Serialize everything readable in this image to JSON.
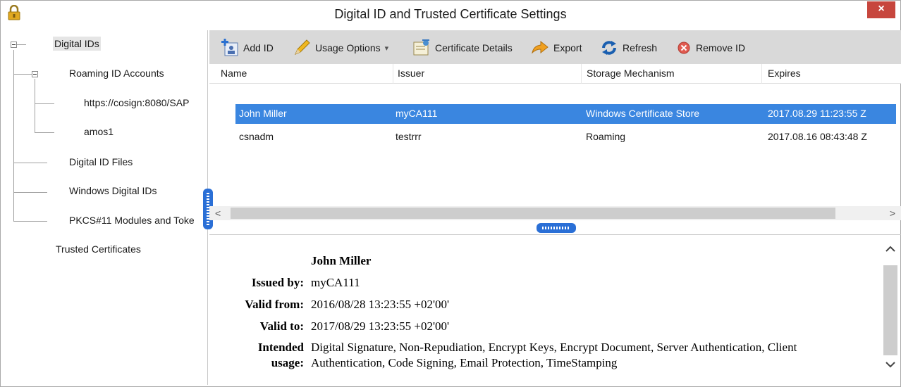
{
  "window": {
    "title": "Digital ID and Trusted Certificate Settings",
    "close_glyph": "×",
    "lock_icon": "lock-icon"
  },
  "tree": {
    "items": [
      {
        "label": "Digital IDs",
        "selected": true
      },
      {
        "label": "Roaming ID Accounts"
      },
      {
        "label": "https://cosign:8080/SAP"
      },
      {
        "label": "amos1"
      },
      {
        "label": "Digital ID Files"
      },
      {
        "label": "Windows Digital IDs"
      },
      {
        "label": "PKCS#11 Modules and Toke"
      },
      {
        "label": "Trusted Certificates"
      }
    ],
    "expander_glyph": "⊟"
  },
  "toolbar": {
    "add_id": "Add ID",
    "usage_options": "Usage Options",
    "certificate_details": "Certificate Details",
    "export": "Export",
    "refresh": "Refresh",
    "remove_id": "Remove ID",
    "dropdown_glyph": "▾"
  },
  "table": {
    "columns": [
      "Name",
      "Issuer",
      "Storage Mechanism",
      "Expires"
    ],
    "rows": [
      {
        "name": "John Miller",
        "issuer": "myCA111",
        "storage": "Windows Certificate Store",
        "expires": "2017.08.29 11:23:55 Z",
        "selected": true
      },
      {
        "name": "csnadm",
        "issuer": "testrrr",
        "storage": "Roaming",
        "expires": "2017.08.16 08:43:48 Z"
      }
    ],
    "scroll_left": "<",
    "scroll_right": ">"
  },
  "details": {
    "name": "John Miller",
    "issued_by_label": "Issued by:",
    "issued_by": "myCA111",
    "valid_from_label": "Valid from:",
    "valid_from": "2016/08/28 13:23:55 +02'00'",
    "valid_to_label": "Valid to:",
    "valid_to": "2017/08/29 13:23:55 +02'00'",
    "intended_label_1": "Intended",
    "intended_label_2": "usage:",
    "intended_line_1": "Digital Signature, Non-Repudiation, Encrypt Keys, Encrypt Document, Server Authentication, Client",
    "intended_line_2": "Authentication, Code Signing, Email Protection, TimeStamping",
    "scroll_up": "^",
    "scroll_down": "v"
  },
  "colors": {
    "selection": "#3a86e0",
    "toolbar_bg": "#d9d9d9",
    "close_bg": "#c7463d",
    "splitter": "#2a6fd6"
  }
}
